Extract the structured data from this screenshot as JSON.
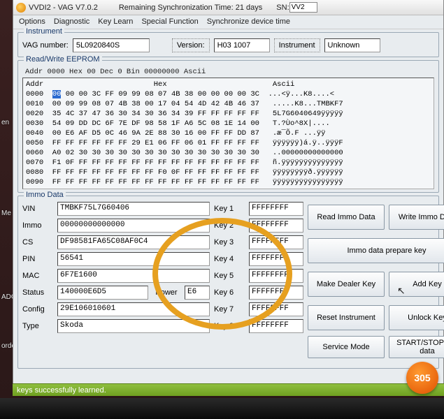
{
  "title": {
    "app": "VVDI2 - VAG V7.0.2",
    "sync": "Remaining Synchronization Time: 21 days",
    "sn_label": "SN:",
    "sn_value": "VV2"
  },
  "menu": {
    "options": "Options",
    "diagnostic": "Diagnostic",
    "keylearn": "Key Learn",
    "special": "Special Function",
    "sync": "Synchronize device time"
  },
  "instrument": {
    "legend": "Instrument",
    "vag_label": "VAG number:",
    "vag_value": "5L0920840S",
    "version_label": "Version:",
    "version_value": "H03 1007",
    "type_label": "Instrument",
    "type_value": "Unknown"
  },
  "eeprom": {
    "legend": "Read/Write EEPROM",
    "header": "Addr  0000  Hex  00  Dec    0  Bin  00000000  Ascii",
    "col_addr": "Addr",
    "col_hex": "Hex",
    "col_ascii": "Ascii",
    "rows": [
      {
        "a": "0000",
        "h": "00 00 00 3C FF 09 99 08 07 4B 38 00 00 00 00 3C",
        "s": "...<ÿ...K8....<"
      },
      {
        "a": "0010",
        "h": "00 09 99 08 07 4B 38 00 17 04 54 4D 42 4B 46 37",
        "s": ".....K8...TMBKF7"
      },
      {
        "a": "0020",
        "h": "35 4C 37 47 36 30 34 30 36 34 39 FF FF FF FF FF",
        "s": "5L7G6040649ÿÿÿÿÿ"
      },
      {
        "a": "0030",
        "h": "54 09 DD DC 6F 7E DF 98 58 1F A6 5C 08 1E 14 00",
        "s": "T.?Ùo^8X|...."
      },
      {
        "a": "0040",
        "h": "00 E6 AF D5 0C 46 9A 2E 88 30 16 00 FF FF DD 87",
        "s": ".æ¯Õ.F ...ÿÿ"
      },
      {
        "a": "0050",
        "h": "FF FF FF FF FF FF 29 E1 06 FF 06 01 FF FF FF FF",
        "s": "ÿÿÿÿÿÿ)á.ÿ..ÿÿÿF"
      },
      {
        "a": "0060",
        "h": "A0 02 30 30 30 30 30 30 30 30 30 30 30 30 30 30",
        "s": "..00000000000000"
      },
      {
        "a": "0070",
        "h": "F1 0F FF FF FF FF FF FF FF FF FF FF FF FF FF FF",
        "s": "ñ.ÿÿÿÿÿÿÿÿÿÿÿÿÿÿ"
      },
      {
        "a": "0080",
        "h": "FF FF FF FF FF FF FF FF F0 0F FF FF FF FF FF FF",
        "s": "ÿÿÿÿÿÿÿÿð.ÿÿÿÿÿÿ"
      },
      {
        "a": "0090",
        "h": "FF FF FF FF FF FF FF FF FF FF FF FF FF FF FF FF",
        "s": "ÿÿÿÿÿÿÿÿÿÿÿÿÿÿÿÿ"
      }
    ]
  },
  "immo": {
    "legend": "Immo Data",
    "labels": {
      "vin": "VIN",
      "immo": "Immo",
      "cs": "CS",
      "pin": "PIN",
      "mac": "MAC",
      "status": "Status",
      "power": "Power",
      "config": "Config",
      "type": "Type",
      "key1": "Key 1",
      "key2": "Key 2",
      "key3": "Key 3",
      "key4": "Key 4",
      "key5": "Key 5",
      "key6": "Key 6",
      "key7": "Key 7",
      "key8": "Key 8"
    },
    "vin": "TMBKF75L7G60406",
    "immo_val": "00000000000000",
    "cs": "DF98581FA65C08AF0C4",
    "pin": "56541",
    "mac": "6F7E1600",
    "status": "140000E6D5",
    "power": "E6",
    "config": "29E106010601",
    "type": "Skoda",
    "key1": "FFFFFFFF",
    "key2": "FFFFFFFF",
    "key3": "FFFFFFFF",
    "key4": "FFFFFFFF",
    "key5": "FFFFFFFF",
    "key6": "FFFFFFFF",
    "key7": "FFFFFFFF",
    "key8": "FFFFFFFF"
  },
  "buttons": {
    "read_immo": "Read Immo Data",
    "write_immo": "Write Immo Data",
    "immo_prep": "Immo data prepare key",
    "make_dealer": "Make Dealer Key",
    "add_key": "Add Key",
    "reset_instr": "Reset Instrument",
    "unlock_key": "Unlock Key",
    "service_mode": "Service Mode",
    "startstop": "START/STOP key data"
  },
  "status": "keys successfully learned.",
  "sidebar": {
    "en": "en",
    "adc": "ADC",
    "me": "Me",
    "orde": "orde"
  },
  "watermark": "305"
}
